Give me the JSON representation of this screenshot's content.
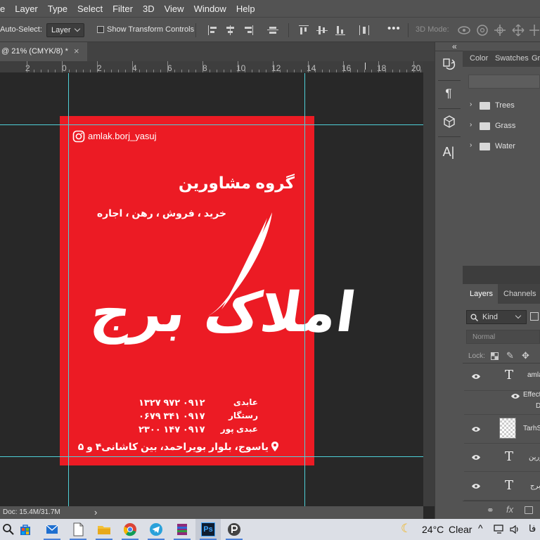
{
  "menubar": {
    "items": [
      "e",
      "Layer",
      "Type",
      "Select",
      "Filter",
      "3D",
      "View",
      "Window",
      "Help"
    ]
  },
  "options_bar": {
    "auto_select_label": "Auto-Select:",
    "auto_select_value": "Layer",
    "show_transform_label": "Show Transform Controls",
    "mode_3d_label": "3D Mode:",
    "more_label": "•••"
  },
  "document_tab": {
    "title": "@ 21% (CMYK/8) *",
    "close_glyph": "×"
  },
  "ruler": {
    "labels": [
      "2",
      "0",
      "2",
      "4",
      "6",
      "8",
      "10",
      "12",
      "14",
      "16",
      "18",
      "20"
    ]
  },
  "flyer": {
    "instagram": "amlak.borj_yasuj",
    "group_title": "گروه مشاورین",
    "services": "خرید ، فروش ، رهن ، اجاره",
    "logo_text": "املاک برج",
    "contacts": [
      {
        "name": "عابدی",
        "phone": "۰۹۱۲ ۹۷۲ ۱۳۲۷"
      },
      {
        "name": "رستگار",
        "phone": "۰۹۱۷ ۳۴۱ ۰۶۷۹"
      },
      {
        "name": "عبدی پور",
        "phone": "۰۹۱۷ ۱۴۷ ۲۳۰۰"
      }
    ],
    "address": "یاسوج، بلوار بویراحمد، بین کاشانی۴ و ۵"
  },
  "status_bar": {
    "doc_info": "Doc: 15.4M/31.7M",
    "arrow": "›"
  },
  "panels": {
    "collapse_glyph": "«",
    "top_tabs": [
      "Color",
      "Swatches",
      "Gr"
    ],
    "folders": [
      "Trees",
      "Grass",
      "Water"
    ],
    "layers_tabs": [
      "Layers",
      "Channels"
    ],
    "kind_label": "Kind",
    "blend_mode": "Normal",
    "lock_label": "Lock:",
    "layers": [
      {
        "type": "text",
        "name": "amla",
        "visible": true
      },
      {
        "type": "effect",
        "name": "Effect",
        "sub": "D",
        "visible": true
      },
      {
        "type": "smart",
        "name": "TarhS",
        "visible": true
      },
      {
        "type": "text",
        "name": "ورین",
        "visible": true
      },
      {
        "type": "text",
        "name": "برج",
        "visible": true
      }
    ],
    "footer_fx": "fx"
  },
  "taskbar": {
    "weather_temp": "24°C",
    "weather_desc": "Clear",
    "lang": "فا"
  },
  "colors": {
    "flyer_red": "#ec1b24",
    "guide_cyan": "#4fd0d8",
    "ui_gray": "#535353",
    "workspace": "#282828"
  }
}
